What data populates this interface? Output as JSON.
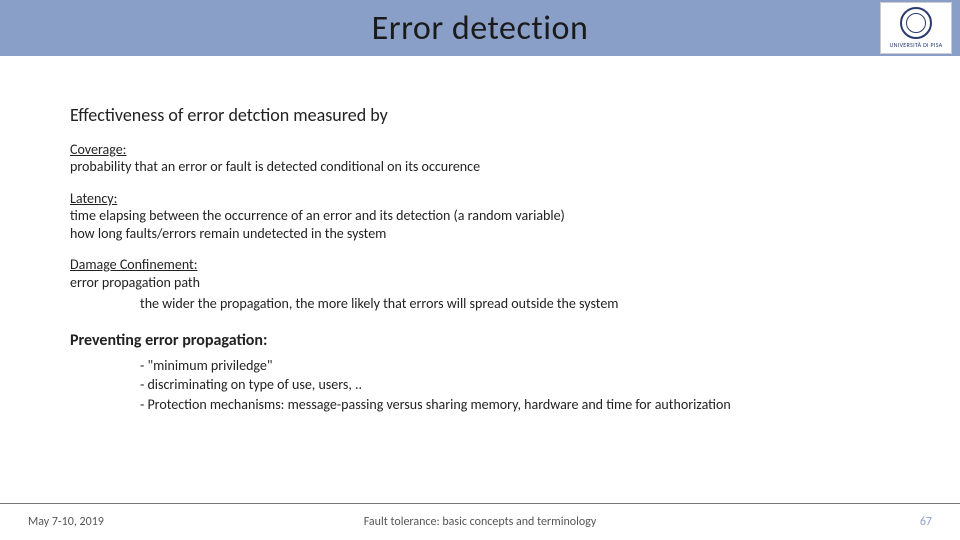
{
  "header": {
    "title": "Error detection",
    "logo_text": "UNIVERSITÀ DI PISA"
  },
  "body": {
    "intro": "Effectiveness of error detction measured by",
    "metrics": {
      "coverage": {
        "label": "Coverage:",
        "desc": "probability that an error or fault is detected conditional on its occurence"
      },
      "latency": {
        "label": "Latency:",
        "line1": "time elapsing between the occurrence of an error and its detection (a random variable)",
        "line2": "how long faults/errors remain undetected in the system"
      },
      "damage": {
        "label": "Damage Confinement:",
        "line1": "error propagation path",
        "line2": "the wider the propagation, the more likely that errors will spread outside the system"
      }
    },
    "preventing": {
      "heading": "Preventing error propagation:",
      "items": [
        "- \"minimum priviledge\"",
        "- discriminating on type of use, users, ..",
        "- Protection mechanisms: message-passing versus sharing memory, hardware and time for authorization"
      ]
    }
  },
  "footer": {
    "date": "May 7-10, 2019",
    "title": "Fault tolerance: basic concepts and terminology",
    "page": "67"
  }
}
